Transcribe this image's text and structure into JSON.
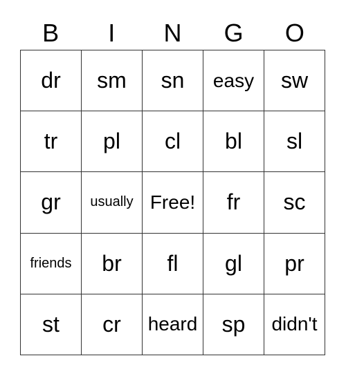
{
  "header": [
    "B",
    "I",
    "N",
    "G",
    "O"
  ],
  "cells": [
    [
      "dr",
      "sm",
      "sn",
      "easy",
      "sw"
    ],
    [
      "tr",
      "pl",
      "cl",
      "bl",
      "sl"
    ],
    [
      "gr",
      "usually",
      "Free!",
      "fr",
      "sc"
    ],
    [
      "friends",
      "br",
      "fl",
      "gl",
      "pr"
    ],
    [
      "st",
      "cr",
      "heard",
      "sp",
      "didn't"
    ]
  ]
}
